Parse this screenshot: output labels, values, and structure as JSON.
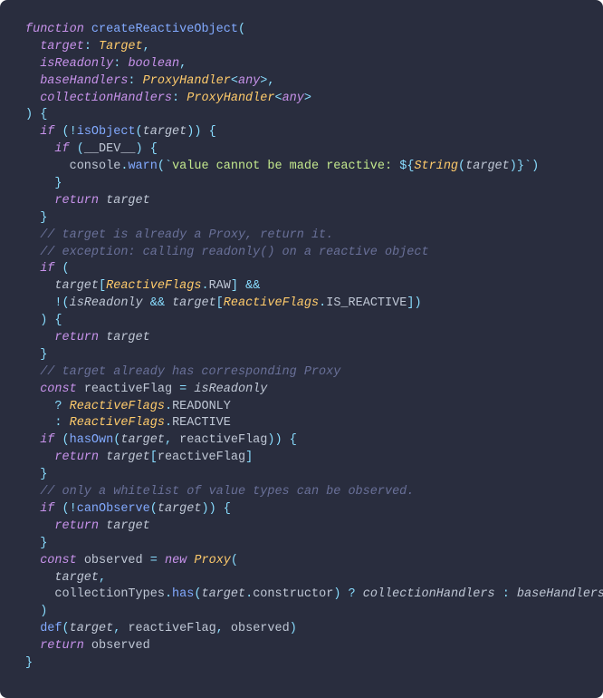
{
  "code": {
    "l1": {
      "kw": "function",
      "fn": "createReactiveObject",
      "po": "("
    },
    "l2": {
      "p1": "target",
      "c": ":",
      "t": "Target",
      "co": ","
    },
    "l3": {
      "p1": "isReadonly",
      "c": ":",
      "t": "boolean",
      "co": ","
    },
    "l4": {
      "p1": "baseHandlers",
      "c": ":",
      "t": "ProxyHandler",
      "lt": "<",
      "ta": "any",
      "gt": ">",
      "co": ","
    },
    "l5": {
      "p1": "collectionHandlers",
      "c": ":",
      "t": "ProxyHandler",
      "lt": "<",
      "ta": "any",
      "gt": ">"
    },
    "l6": {
      "pc": ")",
      "ob": "{"
    },
    "l7": {
      "kw": "if",
      "po": "(",
      "b": "!",
      "fn": "isObject",
      "po2": "(",
      "a": "target",
      "pc": ")",
      ")": ")",
      "ob": "{"
    },
    "l8": {
      "kw": "if",
      "po": "(",
      "v": "__DEV__",
      "pc": ")",
      "ob": "{"
    },
    "l9": {
      "o": "console",
      "d": ".",
      "m": "warn",
      "po": "(",
      "bt": "`",
      "s": "value cannot be made reactive: ",
      "dl": "${",
      "fn": "String",
      "po2": "(",
      "a": "target",
      "pc2": ")",
      "dr": "}",
      "bt2": "`",
      "pc": ")"
    },
    "l10": {
      "cb": "}"
    },
    "l11": {
      "kw": "return",
      "v": "target"
    },
    "l12": {
      "cb": "}"
    },
    "l13": {
      "c": "// target is already a Proxy, return it."
    },
    "l14": {
      "c": "// exception: calling readonly() on a reactive object"
    },
    "l15": {
      "kw": "if",
      "po": "("
    },
    "l16": {
      "v": "target",
      "lb": "[",
      "cls": "ReactiveFlags",
      "d": ".",
      "m": "RAW",
      "rb": "]",
      "amp": "&&"
    },
    "l17": {
      "b": "!",
      "po": "(",
      "v": "isReadonly",
      "amp": "&&",
      "v2": "target",
      "lb": "[",
      "cls": "ReactiveFlags",
      "d": ".",
      "m": "IS_REACTIVE",
      "rb": "]",
      "pc": ")"
    },
    "l18": {
      "pc": ")",
      "ob": "{"
    },
    "l19": {
      "kw": "return",
      "v": "target"
    },
    "l20": {
      "cb": "}"
    },
    "l21": {
      "c": "// target already has corresponding Proxy"
    },
    "l22": {
      "kw": "const",
      "v": "reactiveFlag",
      "eq": "=",
      "v2": "isReadonly"
    },
    "l23": {
      "q": "?",
      "cls": "ReactiveFlags",
      "d": ".",
      "m": "READONLY"
    },
    "l24": {
      "q": ":",
      "cls": "ReactiveFlags",
      "d": ".",
      "m": "REACTIVE"
    },
    "l25": {
      "kw": "if",
      "po": "(",
      "fn": "hasOwn",
      "po2": "(",
      "a": "target",
      "co": ",",
      "a2": "reactiveFlag",
      "pc2": ")",
      "pc": ")",
      "ob": "{"
    },
    "l26": {
      "kw": "return",
      "v": "target",
      "lb": "[",
      "v2": "reactiveFlag",
      "rb": "]"
    },
    "l27": {
      "cb": "}"
    },
    "l28": {
      "c": "// only a whitelist of value types can be observed."
    },
    "l29": {
      "kw": "if",
      "po": "(",
      "b": "!",
      "fn": "canObserve",
      "po2": "(",
      "a": "target",
      "pc2": ")",
      "pc": ")",
      "ob": "{"
    },
    "l30": {
      "kw": "return",
      "v": "target"
    },
    "l31": {
      "cb": "}"
    },
    "l32": {
      "kw": "const",
      "v": "observed",
      "eq": "=",
      "nw": "new",
      "cls": "Proxy",
      "po": "("
    },
    "l33": {
      "v": "target",
      "co": ","
    },
    "l34": {
      "o": "collectionTypes",
      "d": ".",
      "m": "has",
      "po": "(",
      "a": "target",
      "d2": ".",
      "m2": "constructor",
      "pc": ")",
      "q": "?",
      "v2": "collectionHandlers",
      "c": ":",
      "v3": "baseHandlers"
    },
    "l35": {
      "pc": ")"
    },
    "l36": {
      "fn": "def",
      "po": "(",
      "a": "target",
      "co": ",",
      "a2": "reactiveFlag",
      "co2": ",",
      "a3": "observed",
      "pc": ")"
    },
    "l37": {
      "kw": "return",
      "v": "observed"
    },
    "l38": {
      "cb": "}"
    }
  }
}
